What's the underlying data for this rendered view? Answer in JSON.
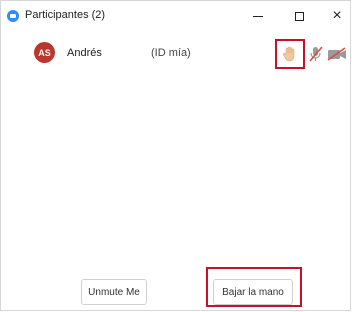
{
  "window": {
    "title": "Participantes (2)",
    "close_glyph": "×"
  },
  "participant": {
    "initials": "AS",
    "name": "Andrés",
    "id_label": "(ID mía)",
    "avatar_color": "#b9372f",
    "hand_raised": true,
    "icons": [
      "raised-hand-icon",
      "microphone-muted-icon",
      "video-camera-off-icon"
    ]
  },
  "actions": {
    "unmute_label": "Unmute Me",
    "lower_hand_label": "Bajar la mano"
  },
  "colors": {
    "highlight": "#c8102e",
    "app_accent": "#2d8cff"
  }
}
